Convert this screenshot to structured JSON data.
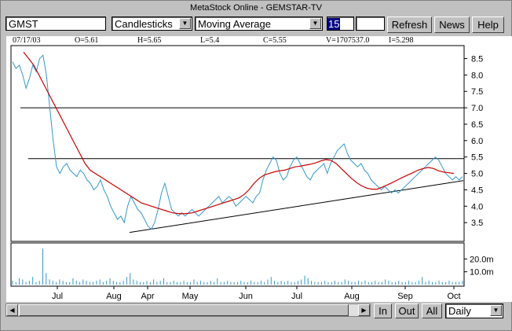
{
  "window": {
    "title": "MetaStock Online - GEMSTAR-TV"
  },
  "toolbar": {
    "symbol": "GMST",
    "chart_style": "Candlesticks",
    "indicator": "Moving Average",
    "period": "15",
    "extra_field": "",
    "refresh_label": "Refresh",
    "news_label": "News",
    "help_label": "Help"
  },
  "stats": {
    "date": "07/17/03",
    "open": "O=5.61",
    "high": "H=5.65",
    "low": "L=5.4",
    "close": "C=5.55",
    "volume": "V=1707537.0",
    "indicator_value": "I=5.298"
  },
  "bottom": {
    "in_label": "In",
    "out_label": "Out",
    "all_label": "All",
    "period_select": "Daily"
  },
  "colors": {
    "price": "#3399cc",
    "moving_average": "#cc0000",
    "lines": "#000000",
    "bg": "#ffffff"
  },
  "chart_data": {
    "type": "line",
    "x_tick_labels": [
      "Jul",
      "Aug",
      "Apr",
      "May",
      "Jun",
      "Jul",
      "Aug",
      "Sep",
      "Oct"
    ],
    "price_axis_labels": [
      "8.5",
      "8.0",
      "7.5",
      "7.0",
      "6.5",
      "6.0",
      "5.5",
      "5.0",
      "4.5",
      "4.0",
      "3.5"
    ],
    "volume_axis_labels": [
      "20.0m",
      "10.0m"
    ],
    "ylim": [
      3.0,
      8.8
    ],
    "grid": false,
    "series": [
      {
        "values": [
          8.4,
          8.2,
          8.3,
          8.0,
          7.6,
          7.9,
          8.3,
          8.1,
          8.5,
          8.6,
          8.0,
          7.0,
          6.0,
          5.2,
          5.0,
          5.2,
          5.3,
          5.1,
          5.0,
          4.9,
          5.1,
          5.0,
          4.8,
          4.7,
          4.5,
          4.6,
          4.8,
          4.5,
          4.3,
          4.0,
          3.8,
          3.6,
          3.7,
          3.5,
          4.0,
          4.3,
          4.1,
          3.9,
          3.8,
          3.6,
          3.4,
          3.3,
          3.5,
          3.9,
          4.4,
          4.7,
          4.3,
          3.9,
          3.8,
          3.7,
          3.8,
          3.7,
          3.8,
          3.9,
          3.8,
          3.7,
          3.8,
          3.9,
          4.0,
          4.1,
          4.2,
          4.3,
          4.1,
          4.2,
          4.3,
          4.2,
          4.0,
          4.1,
          4.2,
          4.3,
          4.2,
          4.1,
          4.3,
          4.4,
          4.8,
          5.1,
          5.3,
          5.5,
          5.4,
          5.0,
          4.8,
          4.9,
          5.2,
          5.4,
          5.5,
          5.3,
          5.1,
          4.9,
          4.8,
          5.0,
          5.1,
          5.2,
          5.3,
          5.0,
          5.3,
          5.5,
          5.7,
          5.8,
          5.9,
          5.6,
          5.4,
          5.3,
          5.2,
          5.3,
          5.1,
          5.0,
          4.8,
          4.7,
          4.6,
          4.5,
          4.6,
          4.5,
          4.4,
          4.5,
          4.4,
          4.5,
          4.6,
          4.7,
          4.8,
          4.9,
          5.0,
          5.1,
          5.2,
          5.3,
          5.4,
          5.5,
          5.4,
          5.2,
          5.0,
          4.9,
          4.8,
          4.9,
          4.8,
          4.9
        ]
      },
      {
        "values": [
          8.7,
          8.5,
          8.3,
          8.0,
          7.7,
          7.4,
          7.1,
          6.8,
          6.5,
          6.2,
          5.9,
          5.6,
          5.3,
          5.1,
          5.0,
          4.9,
          4.8,
          4.7,
          4.6,
          4.5,
          4.4,
          4.3,
          4.2,
          4.1,
          4.05,
          4.0,
          3.95,
          3.9,
          3.85,
          3.8,
          3.78,
          3.77,
          3.78,
          3.8,
          3.85,
          3.9,
          3.95,
          4.0,
          4.05,
          4.1,
          4.15,
          4.2,
          4.25,
          4.35,
          4.5,
          4.7,
          4.85,
          4.95,
          5.0,
          5.05,
          5.08,
          5.1,
          5.15,
          5.2,
          5.22,
          5.25,
          5.28,
          5.32,
          5.38,
          5.42,
          5.4,
          5.3,
          5.15,
          5.0,
          4.85,
          4.72,
          4.62,
          4.55,
          4.52,
          4.52,
          4.58,
          4.65,
          4.72,
          4.8,
          4.88,
          4.95,
          5.02,
          5.1,
          5.15,
          5.18,
          5.15,
          5.08,
          5.04,
          5.02,
          5.0
        ]
      }
    ],
    "volume": [
      3,
      2,
      5,
      4,
      2,
      3,
      6,
      2,
      3,
      28,
      9,
      4,
      3,
      2,
      4,
      3,
      2,
      2,
      5,
      3,
      2,
      4,
      3,
      2,
      2,
      3,
      4,
      2,
      3,
      5,
      3,
      2,
      2,
      3,
      6,
      9,
      4,
      3,
      2,
      2,
      3,
      2,
      4,
      2,
      3,
      5,
      2,
      2,
      3,
      2,
      2,
      3,
      2,
      2,
      4,
      2,
      3,
      2,
      2,
      3,
      2,
      5,
      2,
      2,
      3,
      2,
      2,
      2,
      3,
      2,
      2,
      3,
      2,
      2,
      3,
      2,
      4,
      6,
      3,
      2,
      3,
      2,
      3,
      2,
      2,
      3,
      4,
      7,
      5,
      3,
      2,
      2,
      2,
      3,
      2,
      2,
      3,
      2,
      2,
      4,
      3,
      2,
      2,
      3,
      2,
      3,
      2,
      2,
      3,
      2,
      2,
      4,
      3,
      2,
      2,
      3,
      2,
      2,
      3,
      2,
      2,
      3,
      6,
      2,
      3,
      2,
      2,
      3,
      2,
      2,
      3,
      2,
      2,
      2,
      3
    ]
  }
}
